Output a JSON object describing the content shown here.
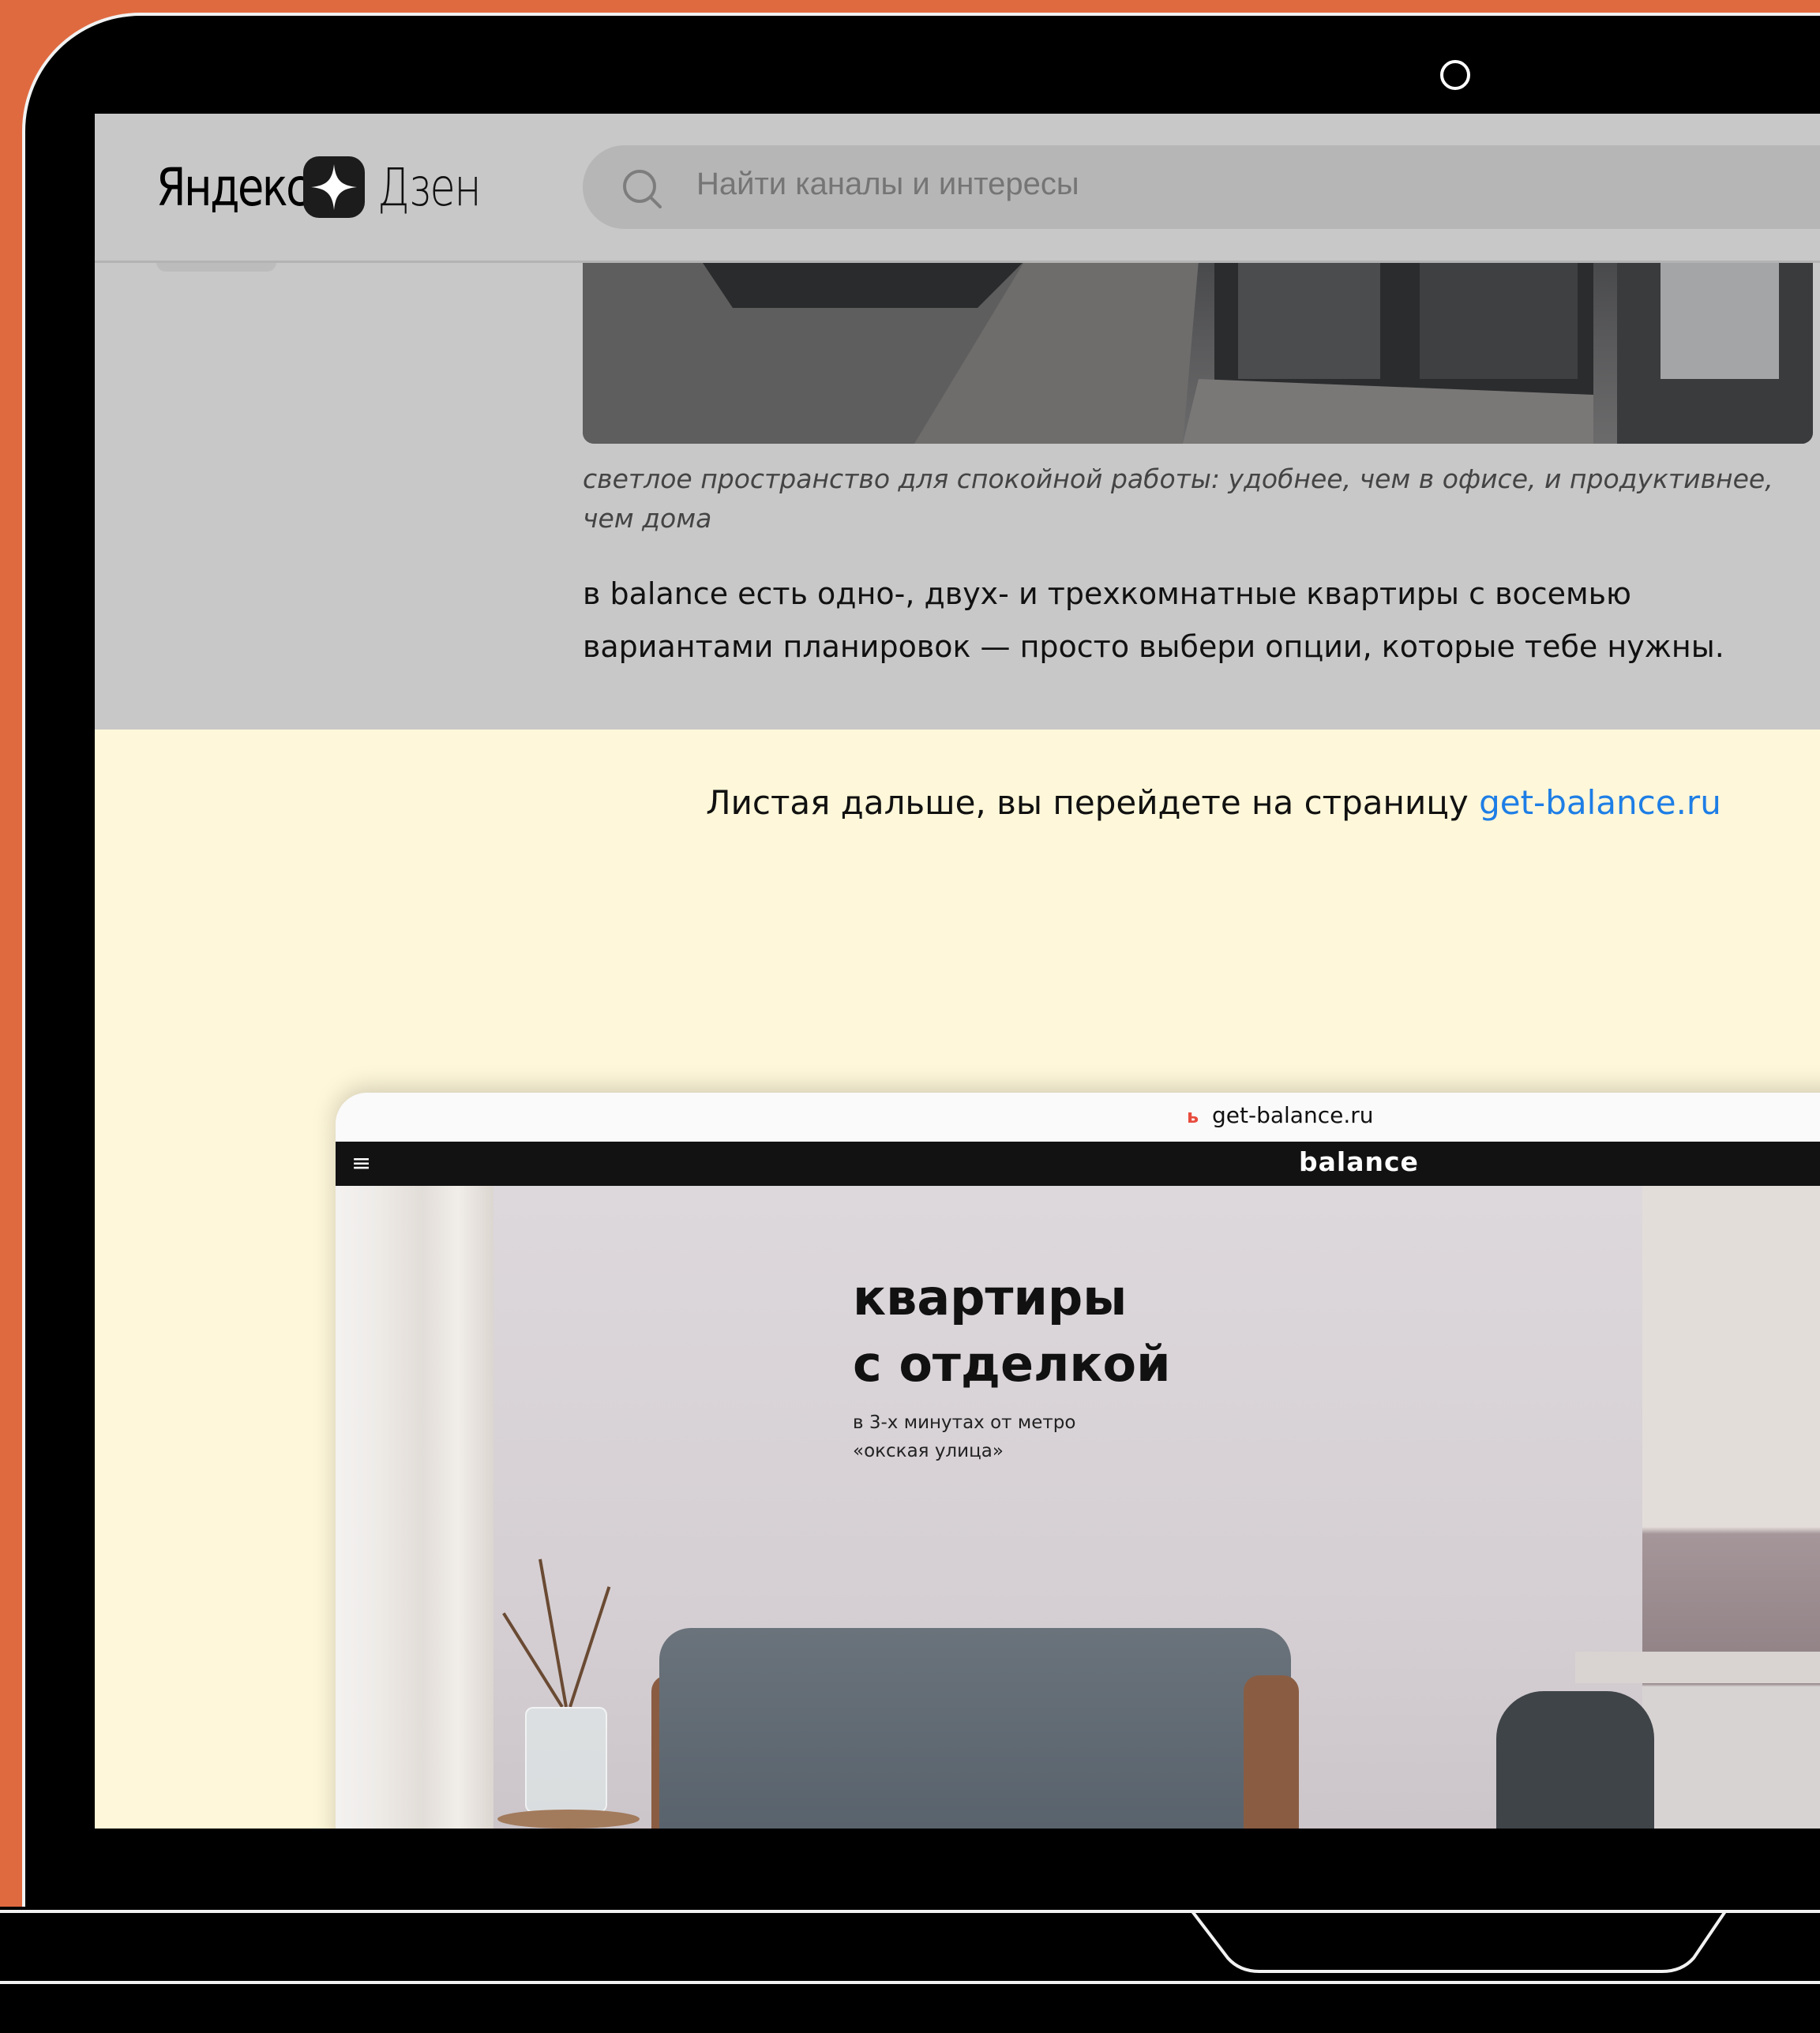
{
  "zen": {
    "logo_word1": "Яндекс",
    "logo_word2": "Дзен",
    "search_placeholder": "Найти каналы и интересы"
  },
  "article": {
    "photo_caption": "светлое пространство для спокойной работы: удобнее, чем в офисе, и продуктивнее, чем дома",
    "paragraph": "в balance есть одно-, двух- и трехкомнатные квартиры с восемью вариантами планировок — просто выбери опции, которые тебе нужны."
  },
  "promo": {
    "lead_text": "Листая дальше, вы перейдете на страницу ",
    "link_text": "get-balance.ru",
    "accent_color": "#1e7ee6",
    "background_color": "#fef7d9"
  },
  "preview_site": {
    "favicon": "ь",
    "url": "get-balance.ru",
    "menu_icon": "≡",
    "logo": "balance",
    "hero_title_line1": "квартиры",
    "hero_title_line2": "с отделкой",
    "hero_sub_line1": "в 3-х минутах от метро",
    "hero_sub_line2": "«окская улица»"
  },
  "device": {
    "frame_color": "#000000",
    "background_color": "#e06a40"
  }
}
